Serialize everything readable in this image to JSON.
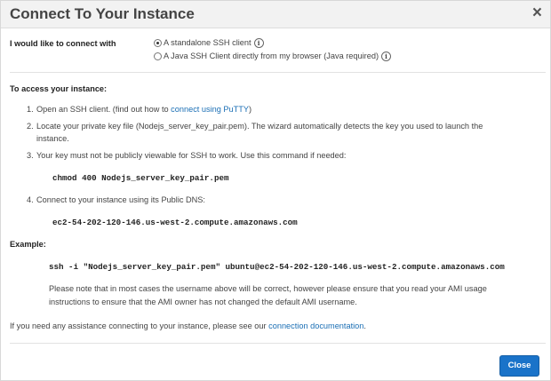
{
  "dialog": {
    "title": "Connect To Your Instance",
    "close_symbol": "×"
  },
  "connect_with": {
    "label": "I would like to connect with",
    "options": [
      {
        "label": "A standalone SSH client",
        "selected": true
      },
      {
        "label": "A Java SSH Client directly from my browser (Java required)",
        "selected": false
      }
    ],
    "info_symbol": "i"
  },
  "instructions": {
    "heading": "To access your instance:",
    "step1_num": "1.",
    "step1_text": "Open an SSH client. (find out how to ",
    "step1_link": "connect using PuTTY",
    "step1_end": ")",
    "step2_num": "2.",
    "step2_line1": "Locate your private key file (Nodejs_server_key_pair.pem). The wizard automatically detects the key you used to launch the",
    "step2_line2": "instance.",
    "step3_num": "3.",
    "step3_text": "Your key must not be publicly viewable for SSH to work. Use this command if needed:",
    "chmod_command": "chmod 400 Nodejs_server_key_pair.pem",
    "step4_num": "4.",
    "step4_text": "Connect to your instance using its Public DNS:",
    "public_dns": "ec2-54-202-120-146.us-west-2.compute.amazonaws.com"
  },
  "example": {
    "heading": "Example:",
    "ssh_command": "ssh -i \"Nodejs_server_key_pair.pem\" ubuntu@ec2-54-202-120-146.us-west-2.compute.amazonaws.com",
    "note_line1": "Please note that in most cases the username above will be correct, however please ensure that you read your AMI usage",
    "note_line2": "instructions to ensure that the AMI owner has not changed the default AMI username."
  },
  "assistance": {
    "text": "If you need any assistance connecting to your instance, please see our ",
    "link": "connection documentation",
    "end": "."
  },
  "footer": {
    "close_label": "Close"
  },
  "colors": {
    "link": "#1b6fb5",
    "primary_button": "#1a73c9",
    "header_bg": "#f2f2f2"
  }
}
